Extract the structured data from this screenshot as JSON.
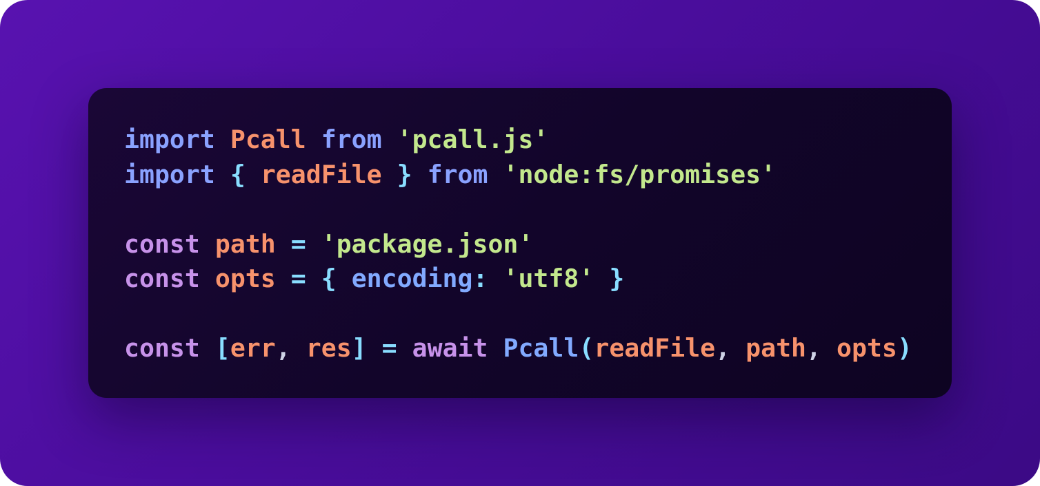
{
  "code": {
    "lines": [
      [
        {
          "text": "import",
          "kind": "kw"
        },
        {
          "text": " ",
          "kind": "pl"
        },
        {
          "text": "Pcall",
          "kind": "id"
        },
        {
          "text": " ",
          "kind": "pl"
        },
        {
          "text": "from",
          "kind": "kw"
        },
        {
          "text": " ",
          "kind": "pl"
        },
        {
          "text": "'pcall.js'",
          "kind": "str"
        }
      ],
      [
        {
          "text": "import",
          "kind": "kw"
        },
        {
          "text": " ",
          "kind": "pl"
        },
        {
          "text": "{",
          "kind": "br"
        },
        {
          "text": " ",
          "kind": "pl"
        },
        {
          "text": "readFile",
          "kind": "id"
        },
        {
          "text": " ",
          "kind": "pl"
        },
        {
          "text": "}",
          "kind": "br"
        },
        {
          "text": " ",
          "kind": "pl"
        },
        {
          "text": "from",
          "kind": "kw"
        },
        {
          "text": " ",
          "kind": "pl"
        },
        {
          "text": "'node:fs/promises'",
          "kind": "str"
        }
      ],
      [],
      [
        {
          "text": "const",
          "kind": "decl"
        },
        {
          "text": " ",
          "kind": "pl"
        },
        {
          "text": "path",
          "kind": "id"
        },
        {
          "text": " ",
          "kind": "pl"
        },
        {
          "text": "=",
          "kind": "op"
        },
        {
          "text": " ",
          "kind": "pl"
        },
        {
          "text": "'package.json'",
          "kind": "str"
        }
      ],
      [
        {
          "text": "const",
          "kind": "decl"
        },
        {
          "text": " ",
          "kind": "pl"
        },
        {
          "text": "opts",
          "kind": "id"
        },
        {
          "text": " ",
          "kind": "pl"
        },
        {
          "text": "=",
          "kind": "op"
        },
        {
          "text": " ",
          "kind": "pl"
        },
        {
          "text": "{",
          "kind": "br"
        },
        {
          "text": " ",
          "kind": "pl"
        },
        {
          "text": "encoding",
          "kind": "prop"
        },
        {
          "text": ":",
          "kind": "op"
        },
        {
          "text": " ",
          "kind": "pl"
        },
        {
          "text": "'utf8'",
          "kind": "str"
        },
        {
          "text": " ",
          "kind": "pl"
        },
        {
          "text": "}",
          "kind": "br"
        }
      ],
      [],
      [
        {
          "text": "const",
          "kind": "decl"
        },
        {
          "text": " ",
          "kind": "pl"
        },
        {
          "text": "[",
          "kind": "br"
        },
        {
          "text": "err",
          "kind": "id"
        },
        {
          "text": ",",
          "kind": "pl"
        },
        {
          "text": " ",
          "kind": "pl"
        },
        {
          "text": "res",
          "kind": "id"
        },
        {
          "text": "]",
          "kind": "br"
        },
        {
          "text": " ",
          "kind": "pl"
        },
        {
          "text": "=",
          "kind": "op"
        },
        {
          "text": " ",
          "kind": "pl"
        },
        {
          "text": "await",
          "kind": "decl"
        },
        {
          "text": " ",
          "kind": "pl"
        },
        {
          "text": "Pcall",
          "kind": "prop"
        },
        {
          "text": "(",
          "kind": "br"
        },
        {
          "text": "readFile",
          "kind": "id"
        },
        {
          "text": ",",
          "kind": "pl"
        },
        {
          "text": " ",
          "kind": "pl"
        },
        {
          "text": "path",
          "kind": "id"
        },
        {
          "text": ",",
          "kind": "pl"
        },
        {
          "text": " ",
          "kind": "pl"
        },
        {
          "text": "opts",
          "kind": "id"
        },
        {
          "text": ")",
          "kind": "br"
        }
      ]
    ]
  },
  "colors": {
    "frame_start": "#5812b0",
    "frame_end": "#3b0a85",
    "card": "#12052a",
    "keyword": "#8aa2ff",
    "declaration": "#c792ea",
    "identifier": "#f7926c",
    "string": "#c3e88d",
    "bracket": "#89ddff",
    "property": "#82aaff"
  }
}
